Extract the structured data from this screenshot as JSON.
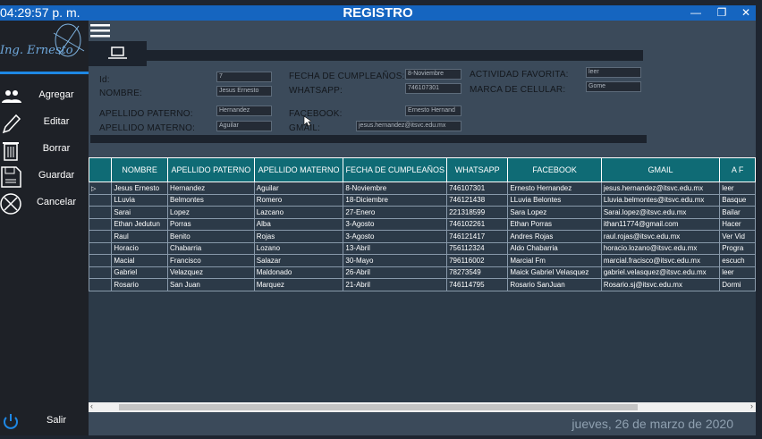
{
  "clock": "04:29:57 p. m.",
  "title": "REGISTRO",
  "window_controls": [
    "—",
    "❐",
    "✕"
  ],
  "logo_text": "Ing. Ernesto",
  "sidebar": [
    {
      "label": "Agregar",
      "icon": "users-icon"
    },
    {
      "label": "Editar",
      "icon": "pencil-icon"
    },
    {
      "label": "Borrar",
      "icon": "trash-icon"
    },
    {
      "label": "Guardar",
      "icon": "save-icon"
    },
    {
      "label": "Cancelar",
      "icon": "cancel-icon"
    }
  ],
  "exit_label": "Salir",
  "form": {
    "id_label": "Id:",
    "id_value": "7",
    "nombre_label": "NOMBRE:",
    "nombre_value": "Jesus Ernesto",
    "ap_label": "APELLIDO PATERNO:",
    "ap_value": "Hernandez",
    "am_label": "APELLIDO MATERNO:",
    "am_value": "Aguilar",
    "fecha_label": "FECHA DE CUMPLEAÑOS:",
    "fecha_value": "8-Noviembre",
    "whatsapp_label": "WHATSAPP:",
    "whatsapp_value": "746107301",
    "facebook_label": "FACEBOOK:",
    "facebook_value": "Ernesto Hernand",
    "gmail_label": "GMAIL:",
    "gmail_value": "jesus.hernandez@itsvc.edu.mx",
    "actividad_label": "ACTIVIDAD FAVORITA:",
    "actividad_value": "leer",
    "marca_label": "MARCA DE CELULAR:",
    "marca_value": "Gome"
  },
  "table": {
    "headers": [
      "NOMBRE",
      "APELLIDO PATERNO",
      "APELLIDO MATERNO",
      "FECHA DE CUMPLEAÑOS",
      "WHATSAPP",
      "FACEBOOK",
      "GMAIL",
      "A F"
    ],
    "rows": [
      [
        "Jesus Ernesto",
        "Hernandez",
        "Aguilar",
        "8-Noviembre",
        "746107301",
        "Ernesto Hernandez",
        "jesus.hernandez@itsvc.edu.mx",
        "leer"
      ],
      [
        "LLuvia",
        "Belmontes",
        "Romero",
        "18-Diciembre",
        "746121438",
        "LLuvia Belontes",
        "Lluvia.belmontes@itsvc.edu.mx",
        "Basque"
      ],
      [
        "Sarai",
        "Lopez",
        "Lazcano",
        "27-Enero",
        "221318599",
        "Sara Lopez",
        "Sarai.lopez@itsvc.edu.mx",
        "Bailar"
      ],
      [
        "Ethan Jedutun",
        "Porras",
        "Alba",
        "3-Agosto",
        "746102261",
        "Ethan Porras",
        "ithan11774@gmail.com",
        "Hacer"
      ],
      [
        "Raul",
        "Benito",
        "Rojas",
        "3-Agosto",
        "746121417",
        "Andres Rojas",
        "raul.rojas@itsvc.edu.mx",
        "Ver Vid"
      ],
      [
        "Horacio",
        "Chabarria",
        "Lozano",
        "13-Abril",
        "756112324",
        "Aldo Chabarria",
        "horacio.lozano@itsvc.edu.mx",
        "Progra"
      ],
      [
        "Macial",
        "Francisco",
        "Salazar",
        "30-Mayo",
        "796116002",
        "Marcial Fm",
        "marcial.fracisco@itsvc.edu.mx",
        "escuch"
      ],
      [
        "Gabriel",
        "Velazquez",
        "Maldonado",
        "26-Abril",
        "78273549",
        "Maick Gabriel Velasquez",
        "gabriel.velasquez@itsvc.edu.mx",
        "leer"
      ],
      [
        "Rosario",
        "San Juan",
        "Marquez",
        "21-Abril",
        "746114795",
        "Rosario SanJuan",
        "Rosario.sj@itsvc.edu.mx",
        "Dormi"
      ]
    ]
  },
  "date": "jueves, 26 de marzo de 2020"
}
